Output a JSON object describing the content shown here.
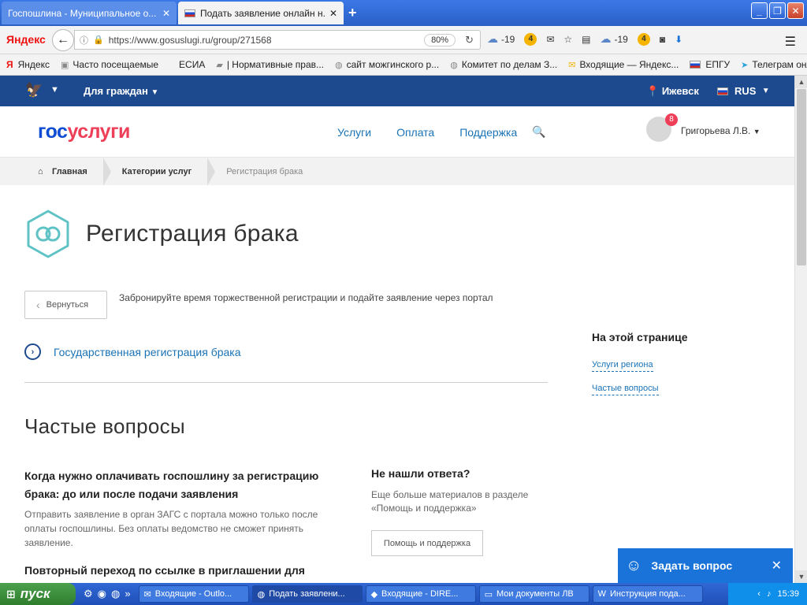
{
  "browser": {
    "tabs": [
      {
        "title": "Госпошлина - Муниципальное о...",
        "active": false
      },
      {
        "title": "Подать заявление онлайн н...",
        "active": true
      }
    ],
    "url": "https://www.gosuslugi.ru/group/271568",
    "zoom": "80%",
    "toolbar": {
      "yandex": "Яндекс",
      "weather1": "-19",
      "coin1": "4",
      "weather2": "-19",
      "coin2": "4"
    },
    "bookmarks": [
      "Яндекс",
      "Часто посещаемые",
      "ЕСИА",
      "| Нормативные прав...",
      "сайт можгинского р...",
      "Комитет по делам З...",
      "Входящие — Яндекс...",
      "ЕПГУ",
      "Телеграм онлайн"
    ]
  },
  "site": {
    "top": {
      "for_citizens": "Для граждан",
      "city": "Ижевск",
      "lang": "RUS"
    },
    "logo": {
      "part1": "гос",
      "part2": "услуги"
    },
    "nav": [
      "Услуги",
      "Оплата",
      "Поддержка"
    ],
    "user": {
      "name": "Григорьева Л.В.",
      "notifications": "8"
    },
    "breadcrumbs": [
      "Главная",
      "Категории услуг",
      "Регистрация брака"
    ],
    "title": "Регистрация брака",
    "back_label": "Вернуться",
    "lead": "Забронируйте время торжественной регистрации и подайте заявление через портал",
    "service_link": "Государственная регистрация брака",
    "onpage": {
      "title": "На этой странице",
      "links": [
        "Услуги региона",
        "Частые вопросы"
      ]
    },
    "faq": {
      "title": "Частые вопросы",
      "q1": "Когда нужно оплачивать госпошлину за регистрацию брака: до или после подачи заявления",
      "a1": "Отправить заявление в орган ЗАГС с портала можно только после оплаты госпошлины. Без оплаты ведомство не сможет принять заявление.",
      "q2": "Повторный переход по ссылке в приглашении для",
      "noans_title": "Не нашли ответа?",
      "noans_text": "Еще больше материалов в разделе «Помощь и поддержка»",
      "help_button": "Помощь и поддержка"
    },
    "ask_widget": "Задать вопрос"
  },
  "taskbar": {
    "start": "пуск",
    "items": [
      "Входящие - Outlo...",
      "Подать заявлени...",
      "Входящие - DIRE...",
      "Мои документы ЛВ",
      "Инструкция пода..."
    ],
    "clock": "15:39"
  }
}
